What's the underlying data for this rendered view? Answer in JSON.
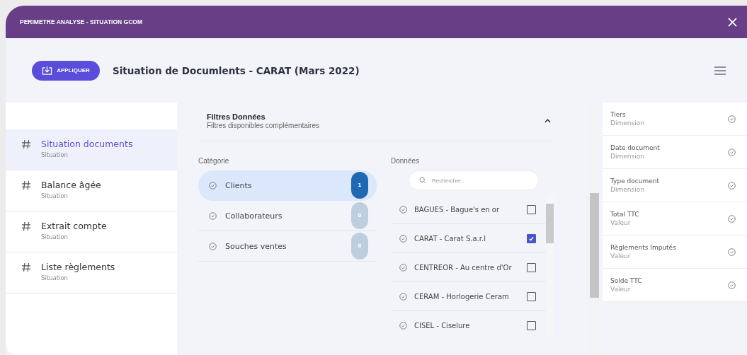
{
  "window": {
    "title": "PERIMETRE ANALYSE - SITUATION GCOM"
  },
  "toolbar": {
    "apply_button": "APPLIQUER",
    "title": "Situation de Documlents - CARAT (Mars 2022)"
  },
  "sidebar": {
    "items": [
      {
        "label": "Situation documents",
        "sub": "Situation",
        "selected": true
      },
      {
        "label": "Balance âgée",
        "sub": "Situation",
        "selected": false
      },
      {
        "label": "Extrait compte",
        "sub": "Situation",
        "selected": false
      },
      {
        "label": "Liste règlements",
        "sub": "Situation",
        "selected": false
      }
    ]
  },
  "filters": {
    "title": "Filtres Données",
    "subtitle": "Filtres disponibles complémentaires",
    "expanded": true,
    "category_heading": "Catégorie",
    "categories": [
      {
        "label": "Clients",
        "count": "1",
        "selected": true
      },
      {
        "label": "Collaborateurs",
        "count": "0",
        "selected": false
      },
      {
        "label": "Souches ventes",
        "count": "0",
        "selected": false
      }
    ],
    "data_heading": "Données",
    "search": {
      "placeholder": "Rechercher.."
    },
    "data": [
      {
        "label": "BAGUES - Bague's en or",
        "checked": false
      },
      {
        "label": "CARAT - Carat S.a.r.l",
        "checked": true
      },
      {
        "label": "CENTREOR - Au centre d'Or",
        "checked": false
      },
      {
        "label": "CERAM - Horlogerie Ceram",
        "checked": false
      },
      {
        "label": "CISEL - Ciselure",
        "checked": false
      }
    ]
  },
  "fields": [
    {
      "name": "Tiers",
      "type": "Dimension"
    },
    {
      "name": "Date document",
      "type": "Dimension"
    },
    {
      "name": "Type document",
      "type": "Dimension"
    },
    {
      "name": "Total TTC",
      "type": "Valeur"
    },
    {
      "name": "Règlements Imputés",
      "type": "Valeur"
    },
    {
      "name": "Solde TTC",
      "type": "Valeur"
    }
  ]
}
